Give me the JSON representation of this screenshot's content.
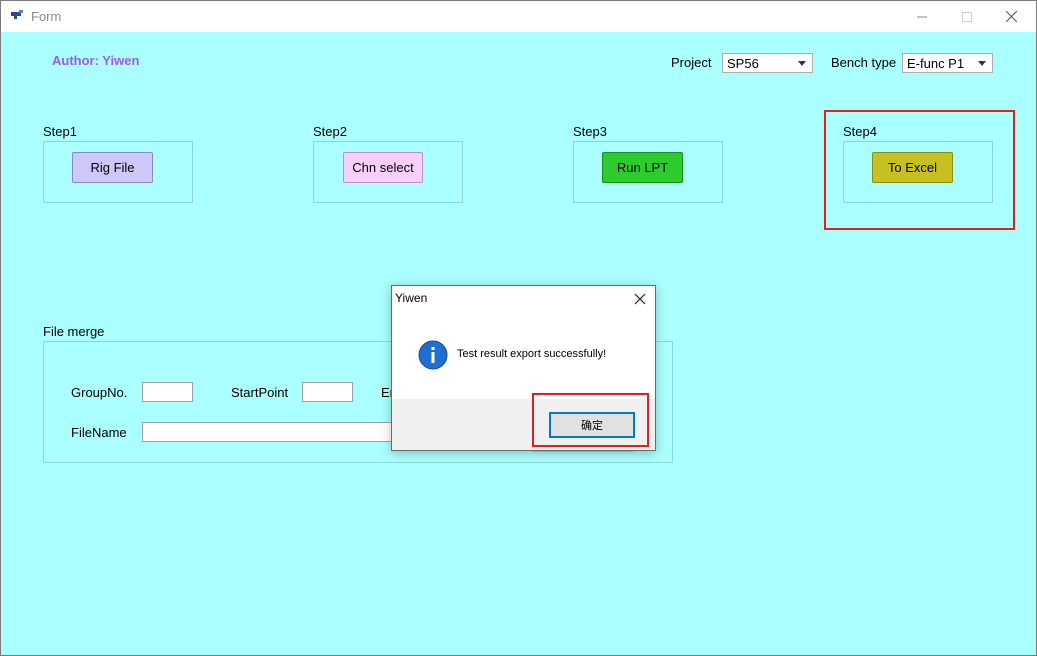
{
  "window": {
    "title": "Form",
    "controls": {
      "minimize": "minimize-icon",
      "maximize": "maximize-icon",
      "close": "close-icon"
    }
  },
  "author": "Author: Yiwen",
  "project": {
    "label": "Project",
    "value": "SP56"
  },
  "bench": {
    "label": "Bench type",
    "value": "E-func P1"
  },
  "steps": [
    {
      "label": "Step1",
      "button": "Rig File",
      "color": "#ccc8f8"
    },
    {
      "label": "Step2",
      "button": "Chn select",
      "color": "#f8cff8"
    },
    {
      "label": "Step3",
      "button": "Run LPT",
      "color": "#2ccc2c"
    },
    {
      "label": "Step4",
      "button": "To Excel",
      "color": "#c6c023"
    }
  ],
  "file_merge": {
    "label": "File merge",
    "group_no_label": "GroupNo.",
    "group_no_value": "",
    "start_point_label": "StartPoint",
    "start_point_value": "",
    "end_point_label_visible": "Er",
    "file_name_label": "FileName",
    "file_name_value": ""
  },
  "dialog": {
    "title": "Yiwen",
    "message": "Test result export successfully!",
    "ok_label": "确定",
    "icon": "info-icon"
  },
  "colors": {
    "background": "#aaffff",
    "author": "#a259f0",
    "highlight": "#e02020",
    "ok_focus": "#0078d7"
  }
}
